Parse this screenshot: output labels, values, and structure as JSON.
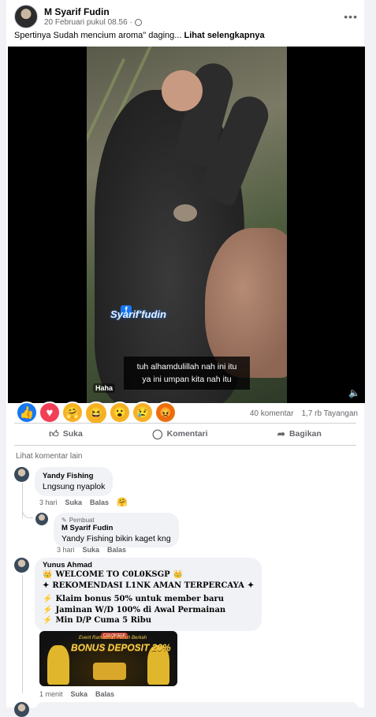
{
  "post": {
    "author": "M Syarif Fudin",
    "timestamp": "20 Februari pukul 08.56",
    "caption": "Spertinya Sudah mencium aroma\" daging...",
    "see_more": "Lihat selengkapnya",
    "video": {
      "watermark": "Syarif'fudin",
      "subtitle_line1": "tuh alhamdulillah nah ini itu",
      "subtitle_line2": "ya ini umpan kita nah itu",
      "reaction_tag": "Haha"
    },
    "stats": {
      "comments": "40 komentar",
      "views": "1,7 rb Tayangan"
    },
    "actions": {
      "like": "Suka",
      "comment": "Komentari",
      "share": "Bagikan"
    }
  },
  "comments_section": {
    "view_more": "Lihat komentar lain",
    "comments": [
      {
        "author": "Yandy Fishing",
        "text": "Lngsung nyaplok",
        "time": "3 hari",
        "like": "Suka",
        "reply": "Balas"
      },
      {
        "badge": "Pembuat",
        "author": "M Syarif Fudin",
        "text": "Yandy Fishing bikin kaget kng",
        "time": "3 hari",
        "like": "Suka",
        "reply": "Balas"
      },
      {
        "author": "Yunus Ahmad",
        "lines": [
          "WELCOME TO C0L0KSGP",
          "REKOMENDASI L1NK AMAN TERPERCAYA",
          "Klaim bonus 50% untuk member baru",
          "Jaminan W/D 100% di Awal Permainan",
          "Min D/P Cuma 5 Ribu"
        ],
        "banner": {
          "logo": "COLOKSGP",
          "subtitle": "Event Ramadhan Penuh Berkah",
          "title": "BONUS DEPOSIT 20%"
        },
        "time": "1 menit",
        "like": "Suka",
        "reply": "Balas"
      }
    ]
  }
}
